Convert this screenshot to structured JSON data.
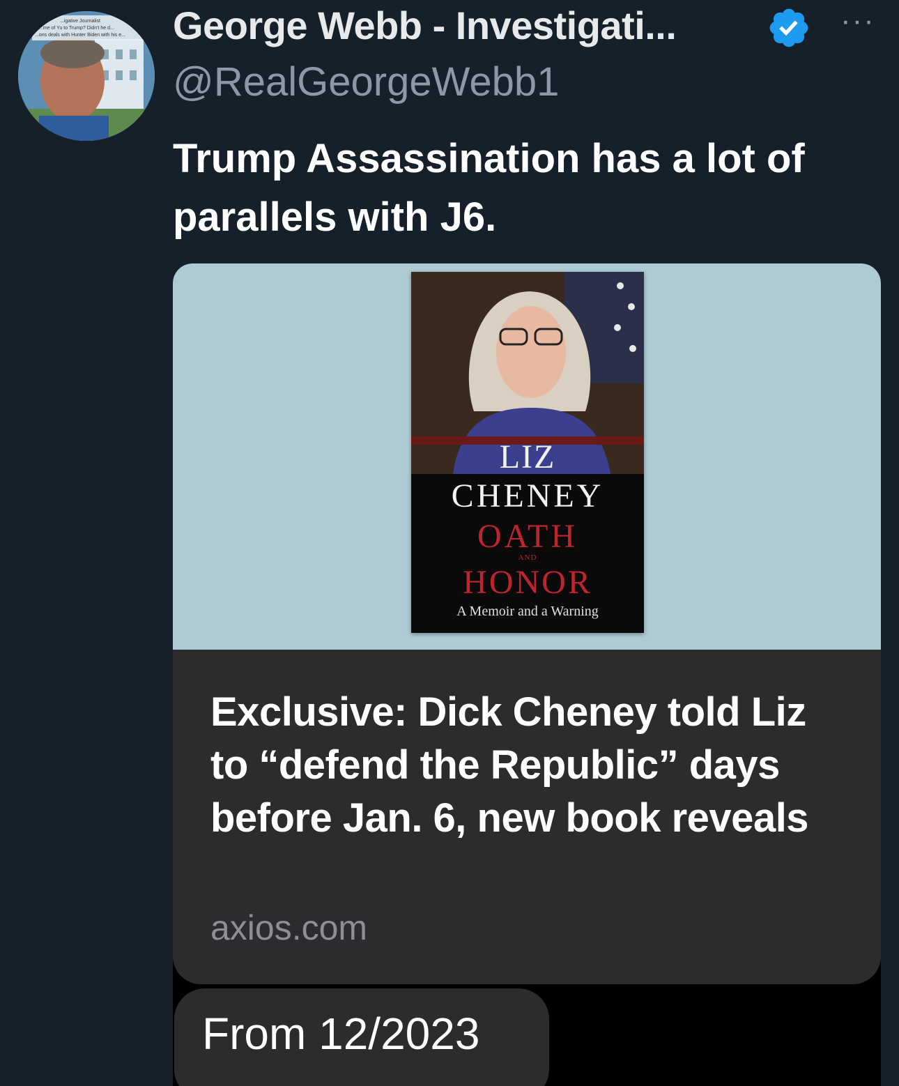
{
  "tweet": {
    "display_name": "George Webb - Investigati...",
    "handle": "@RealGeorgeWebb1",
    "text": "Trump Assassination has a lot of parallels with J6.",
    "verified": true,
    "more_icon": "more-horizontal-icon",
    "avatar_overlay_lines": [
      "...igative Journalist",
      "...me of Yu to Trump? Didn't he d...",
      "...ons deals with Hunter Biden with his e..."
    ]
  },
  "embed": {
    "book": {
      "author_first": "LIZ",
      "author_last": "CHENEY",
      "title_first": "OATH",
      "title_and": "AND",
      "title_second": "HONOR",
      "subtitle": "A Memoir and a Warning"
    },
    "headline": "Exclusive: Dick Cheney told Liz to “defend the Republic” days before Jan. 6, new book reveals",
    "domain": "axios.com",
    "message": "From 12/2023"
  },
  "colors": {
    "background": "#15202b",
    "card": "#2c2c2e",
    "card_image_bg": "#aecbd4",
    "verified_blue": "#1d9bf0",
    "book_red": "#c0252d"
  }
}
